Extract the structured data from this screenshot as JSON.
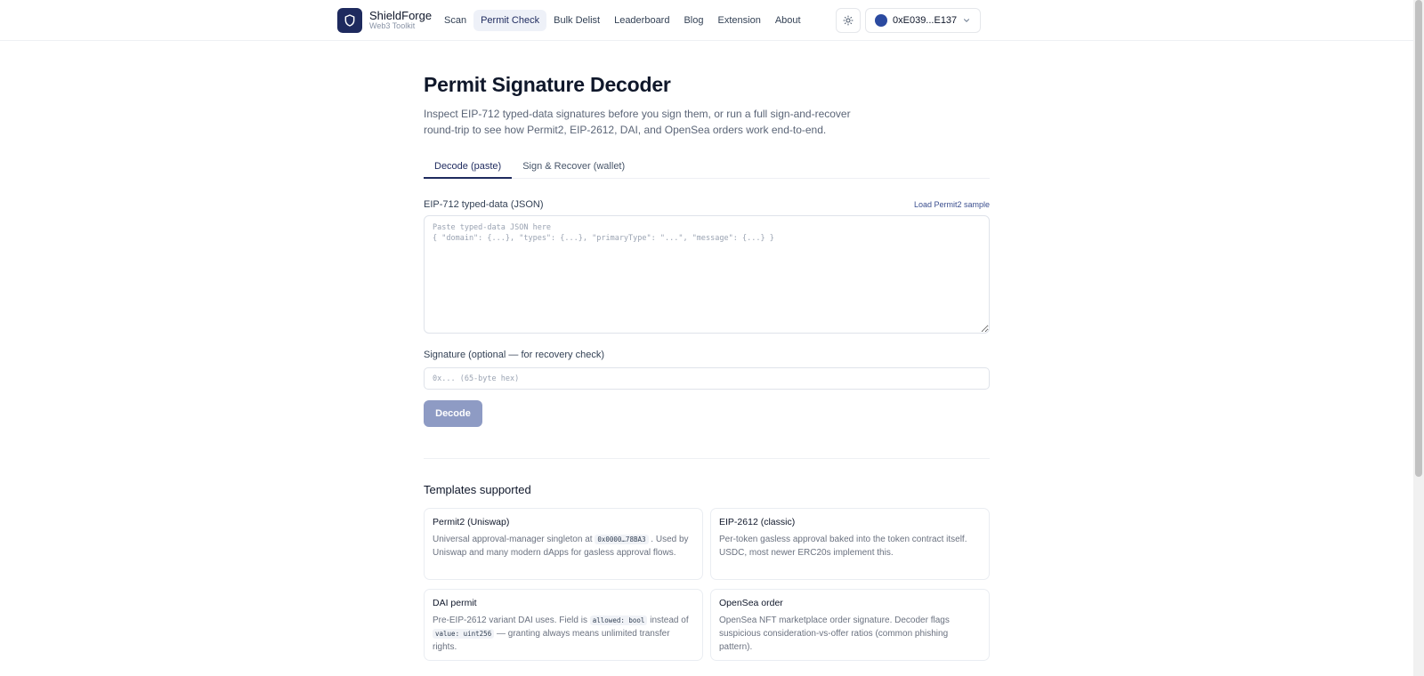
{
  "header": {
    "brand_name": "ShieldForge",
    "brand_sub": "Web3 Toolkit",
    "nav": [
      {
        "label": "Scan",
        "active": false
      },
      {
        "label": "Permit Check",
        "active": true
      },
      {
        "label": "Bulk Delist",
        "active": false
      },
      {
        "label": "Leaderboard",
        "active": false
      },
      {
        "label": "Blog",
        "active": false
      },
      {
        "label": "Extension",
        "active": false
      },
      {
        "label": "About",
        "active": false
      }
    ],
    "wallet_label": "0xE039...E137"
  },
  "main": {
    "title": "Permit Signature Decoder",
    "description": "Inspect EIP-712 typed-data signatures before you sign them, or run a full sign-and-recover round-trip to see how Permit2, EIP-2612, DAI, and OpenSea orders work end-to-end.",
    "tabs": [
      {
        "label": "Decode (paste)",
        "active": true
      },
      {
        "label": "Sign & Recover (wallet)",
        "active": false
      }
    ],
    "typed_data": {
      "label": "EIP-712 typed-data (JSON)",
      "sample_link": "Load Permit2 sample",
      "placeholder": "Paste typed-data JSON here\n{ \"domain\": {...}, \"types\": {...}, \"primaryType\": \"...\", \"message\": {...} }",
      "value": ""
    },
    "signature": {
      "label": "Signature (optional — for recovery check)",
      "placeholder": "0x... (65-byte hex)",
      "value": ""
    },
    "decode_button": "Decode"
  },
  "templates": {
    "title": "Templates supported",
    "cards": [
      {
        "title": "Permit2 (Uniswap)",
        "body_before": "Universal approval-manager singleton at ",
        "code1": "0x0000…78BA3",
        "body_mid": " . Used by Uniswap and many modern dApps for gasless approval flows.",
        "code2": "",
        "body_after": ""
      },
      {
        "title": "EIP-2612 (classic)",
        "body_before": "Per-token gasless approval baked into the token contract itself. USDC, most newer ERC20s implement this.",
        "code1": "",
        "body_mid": "",
        "code2": "",
        "body_after": ""
      },
      {
        "title": "DAI permit",
        "body_before": "Pre-EIP-2612 variant DAI uses. Field is ",
        "code1": "allowed: bool",
        "body_mid": " instead of ",
        "code2": "value: uint256",
        "body_after": " — granting always means unlimited transfer rights."
      },
      {
        "title": "OpenSea order",
        "body_before": "OpenSea NFT marketplace order signature. Decoder flags suspicious consideration-vs-offer ratios (common phishing pattern).",
        "code1": "",
        "body_mid": "",
        "code2": "",
        "body_after": ""
      }
    ]
  },
  "colors": {
    "brand": "#1e2a5e",
    "decode_button": "#8e9bc4",
    "wallet_dot": "#2b4aa0"
  },
  "icons": {
    "logo": "shield-icon",
    "theme": "sun-icon",
    "wallet_chevron": "chevron-down-icon"
  }
}
